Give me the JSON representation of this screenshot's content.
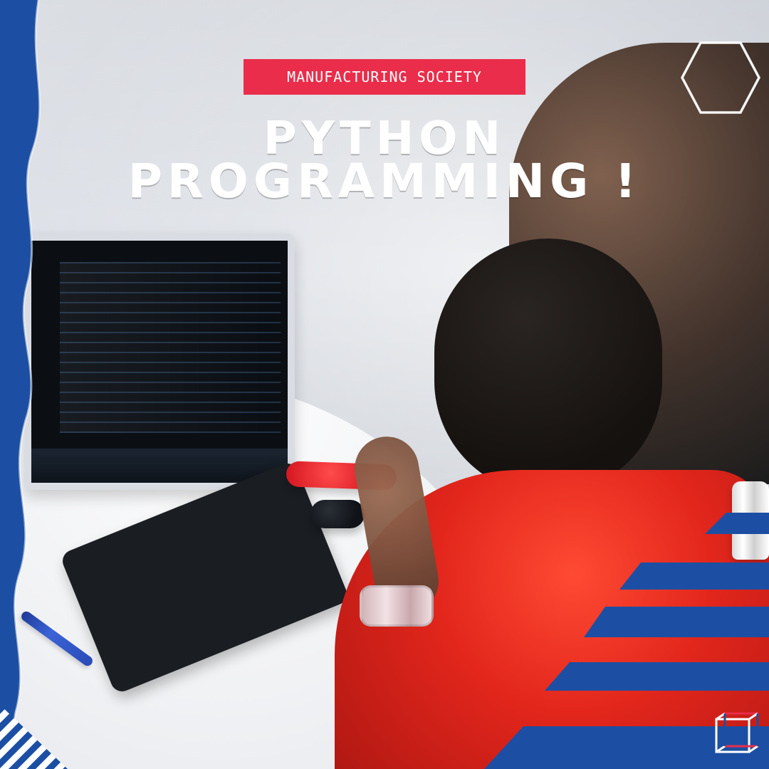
{
  "poster": {
    "label": "MANUFACTURING SOCIETY",
    "title_line1": "PYTHON",
    "title_line2": "PROGRAMMING !"
  },
  "colors": {
    "accent_red": "#ea2d4a",
    "brand_blue": "#1c4fa3",
    "white": "#ffffff"
  },
  "icons": {
    "top_right_shape": "hexagon-outline-icon",
    "bottom_right_logo": "cube-logo-icon"
  }
}
